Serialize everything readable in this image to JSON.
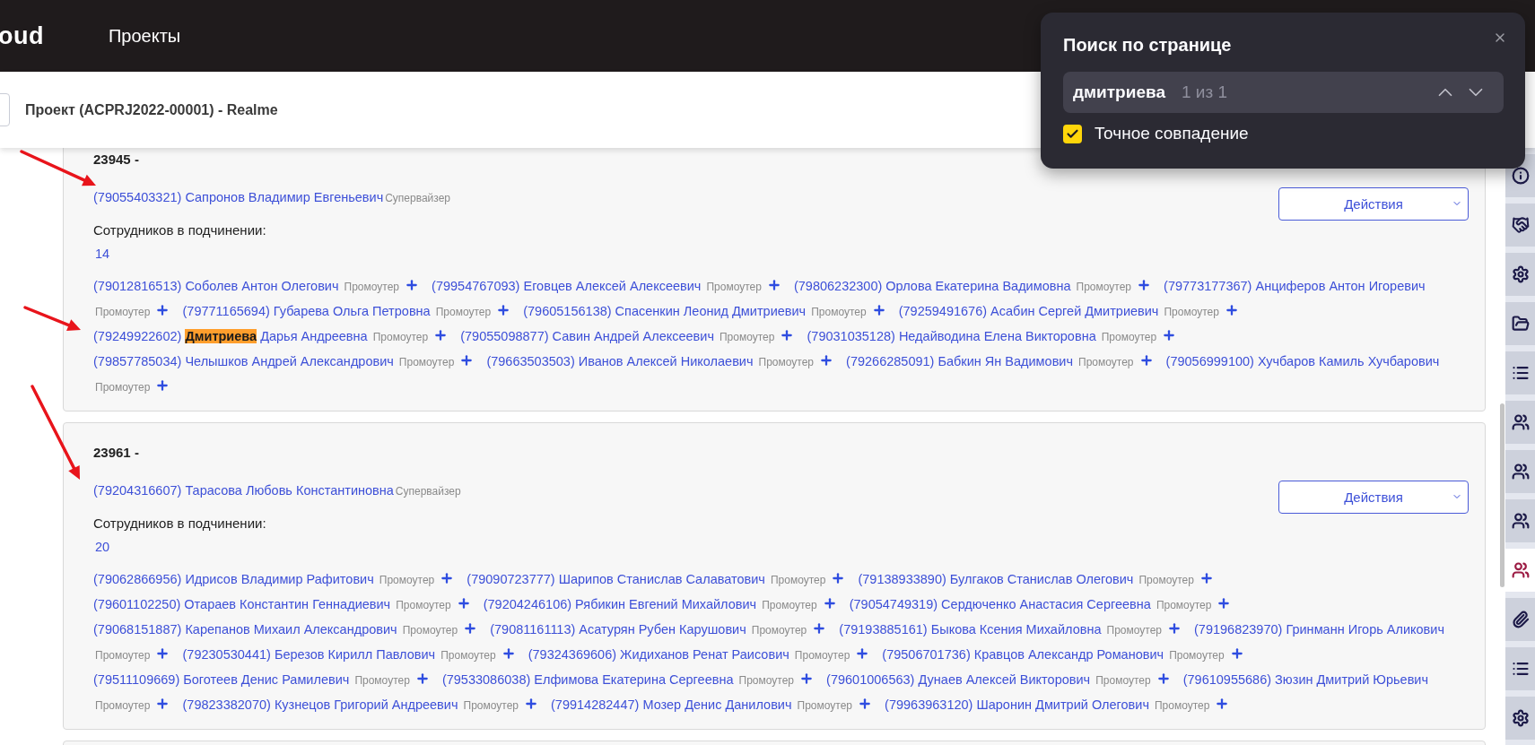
{
  "top_bar": {
    "logo": "oud",
    "nav": "Проекты"
  },
  "header": {
    "title": "Проект (ACPRJ2022-00001) - Realme"
  },
  "find_bar": {
    "title": "Поиск по странице",
    "query": "дмитриева",
    "match_count": "1 из 1",
    "exact_match": {
      "label": "Точное совпадение",
      "checked": true
    }
  },
  "cards": [
    {
      "number": "23945 -",
      "actions": "Действия",
      "supervisor": {
        "contact": "(79055403321) Сапронов Владимир Евгеньевич",
        "role": "Супервайзер"
      },
      "subordinates_label": "Сотрудников в подчинении:",
      "subordinates_count": "14",
      "employees": [
        {
          "contact": "(79012816513) Соболев Антон Олегович",
          "role": "Промоутер"
        },
        {
          "contact": "(79954767093) Еговцев Алексей Алексеевич",
          "role": "Промоутер"
        },
        {
          "contact": "(79806232300) Орлова Екатерина Вадимовна",
          "role": "Промоутер"
        },
        {
          "contact": "(79773177367) Анциферов Антон Игоревич",
          "role": "Промоутер"
        },
        {
          "contact": "(79771165694) Губарева Ольга Петровна",
          "role": "Промоутер"
        },
        {
          "contact": "(79605156138) Спасенкин Леонид Дмитриевич",
          "role": "Промоутер"
        },
        {
          "contact": "(79259491676) Асабин Сергей Дмитриевич",
          "role": "Промоутер"
        },
        {
          "contact": "(79249922602)",
          "highlight": "Дмитриева",
          "contact_rest": "Дарья Андреевна",
          "role": "Промоутер"
        },
        {
          "contact": "(79055098877) Савин Андрей Алексеевич",
          "role": "Промоутер"
        },
        {
          "contact": "(79031035128) Недайводина Елена Викторовна",
          "role": "Промоутер"
        },
        {
          "contact": "(79857785034) Челышков Андрей Александрович",
          "role": "Промоутер"
        },
        {
          "contact": "(79663503503) Иванов Алексей Николаевич",
          "role": "Промоутер"
        },
        {
          "contact": "(79266285091) Бабкин Ян Вадимович",
          "role": "Промоутер"
        },
        {
          "contact": "(79056999100) Хучбаров Камиль Хучбарович",
          "role": "Промоутер"
        }
      ]
    },
    {
      "number": "23961 -",
      "actions": "Действия",
      "supervisor": {
        "contact": "(79204316607) Тарасова Любовь Константиновна",
        "role": "Супервайзер"
      },
      "subordinates_label": "Сотрудников в подчинении:",
      "subordinates_count": "20",
      "employees": [
        {
          "contact": "(79062866956) Идрисов Владимир Рафитович",
          "role": "Промоутер"
        },
        {
          "contact": "(79090723777) Шарипов Станислав Салаватович",
          "role": "Промоутер"
        },
        {
          "contact": "(79138933890) Булгаков Станислав Олегович",
          "role": "Промоутер"
        },
        {
          "contact": "(79601102250) Отараев Константин Геннадиевич",
          "role": "Промоутер"
        },
        {
          "contact": "(79204246106) Рябикин Евгений Михайлович",
          "role": "Промоутер"
        },
        {
          "contact": "(79054749319) Сердюченко Анастасия Сергеевна",
          "role": "Промоутер"
        },
        {
          "contact": "(79068151887) Карепанов Михаил Александрович",
          "role": "Промоутер"
        },
        {
          "contact": "(79081161113) Асатурян Рубен Карушович",
          "role": "Промоутер"
        },
        {
          "contact": "(79193885161) Быкова Ксения Михайловна",
          "role": "Промоутер"
        },
        {
          "contact": "(79196823970) Гринманн Игорь Аликович",
          "role": "Промоутер"
        },
        {
          "contact": "(79230530441) Березов Кирилл Павлович",
          "role": "Промоутер"
        },
        {
          "contact": "(79324369606) Жидиханов Ренат Раисович",
          "role": "Промоутер"
        },
        {
          "contact": "(79506701736) Кравцов Александр Романович",
          "role": "Промоутер"
        },
        {
          "contact": "(79511109669) Боготеев Денис Рамилевич",
          "role": "Промоутер"
        },
        {
          "contact": "(79533086038) Елфимова Екатерина Сергеевна",
          "role": "Промоутер"
        },
        {
          "contact": "(79601006563) Дунаев Алексей Викторович",
          "role": "Промоутер"
        },
        {
          "contact": "(79610955686) Зюзин Дмитрий Юрьевич",
          "role": "Промоутер"
        },
        {
          "contact": "(79823382070) Кузнецов Григорий Андреевич",
          "role": "Промоутер"
        },
        {
          "contact": "(79914282447) Мозер Денис Данилович",
          "role": "Промоутер"
        },
        {
          "contact": "(79963963120) Шаронин Дмитрий Олегович",
          "role": "Промоутер"
        }
      ]
    }
  ],
  "sidebar": {
    "items": [
      {
        "kind": "info",
        "selected": false
      },
      {
        "kind": "handshake",
        "selected": false
      },
      {
        "kind": "settings",
        "selected": false
      },
      {
        "kind": "folder",
        "selected": false
      },
      {
        "kind": "list",
        "selected": false
      },
      {
        "kind": "users",
        "selected": false
      },
      {
        "kind": "users",
        "selected": false
      },
      {
        "kind": "users",
        "selected": false
      },
      {
        "kind": "users",
        "selected": true
      },
      {
        "kind": "paperclip",
        "selected": false
      },
      {
        "kind": "list",
        "selected": false
      },
      {
        "kind": "settings",
        "selected": false
      }
    ]
  }
}
